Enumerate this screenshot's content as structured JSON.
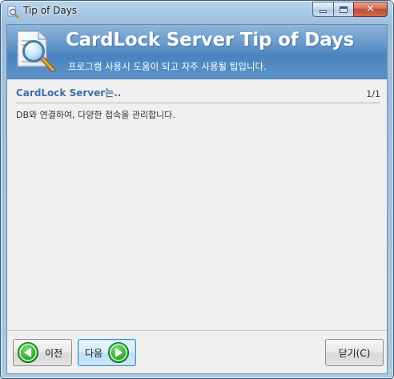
{
  "window": {
    "title": "Tip of Days",
    "icon": "magnifier-document-icon"
  },
  "banner": {
    "title": "CardLock Server Tip of Days",
    "subtitle": "프로그램 사용시 도움이 되고 자주 사용될 팁입니다.",
    "icon": "magnifier-document-icon"
  },
  "tip": {
    "heading": "CardLock Server는..",
    "counter": "1/1",
    "body": "DB와 연결하여, 다양한 접속을 관리합니다."
  },
  "buttons": {
    "prev_label": "이전",
    "next_label": "다음",
    "close_label": "닫기(C)"
  },
  "colors": {
    "banner": "#5a90c6",
    "heading": "#3f6ea6",
    "arrow_green": "#2fae2f",
    "close_button": "#c04a30"
  }
}
